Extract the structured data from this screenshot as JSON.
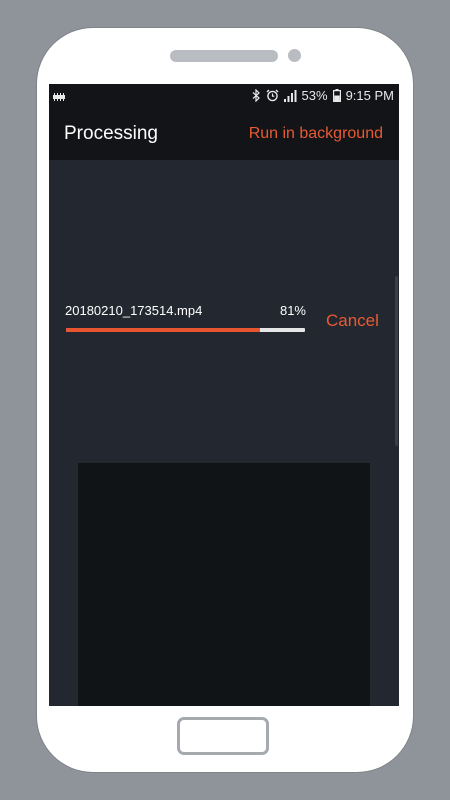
{
  "status_bar": {
    "battery_percent": "53%",
    "time": "9:15 PM",
    "icons": [
      "notification-icon",
      "bluetooth-icon",
      "alarm-icon",
      "signal-icon",
      "battery-icon"
    ]
  },
  "header": {
    "title": "Processing",
    "run_background_label": "Run in background"
  },
  "task": {
    "file_name": "20180210_173514.mp4",
    "progress_label": "81%",
    "progress_value": 0.81,
    "cancel_label": "Cancel"
  },
  "colors": {
    "accent": "#e85a33",
    "background": "#222730",
    "appbar": "#121418",
    "preview": "#111417"
  }
}
